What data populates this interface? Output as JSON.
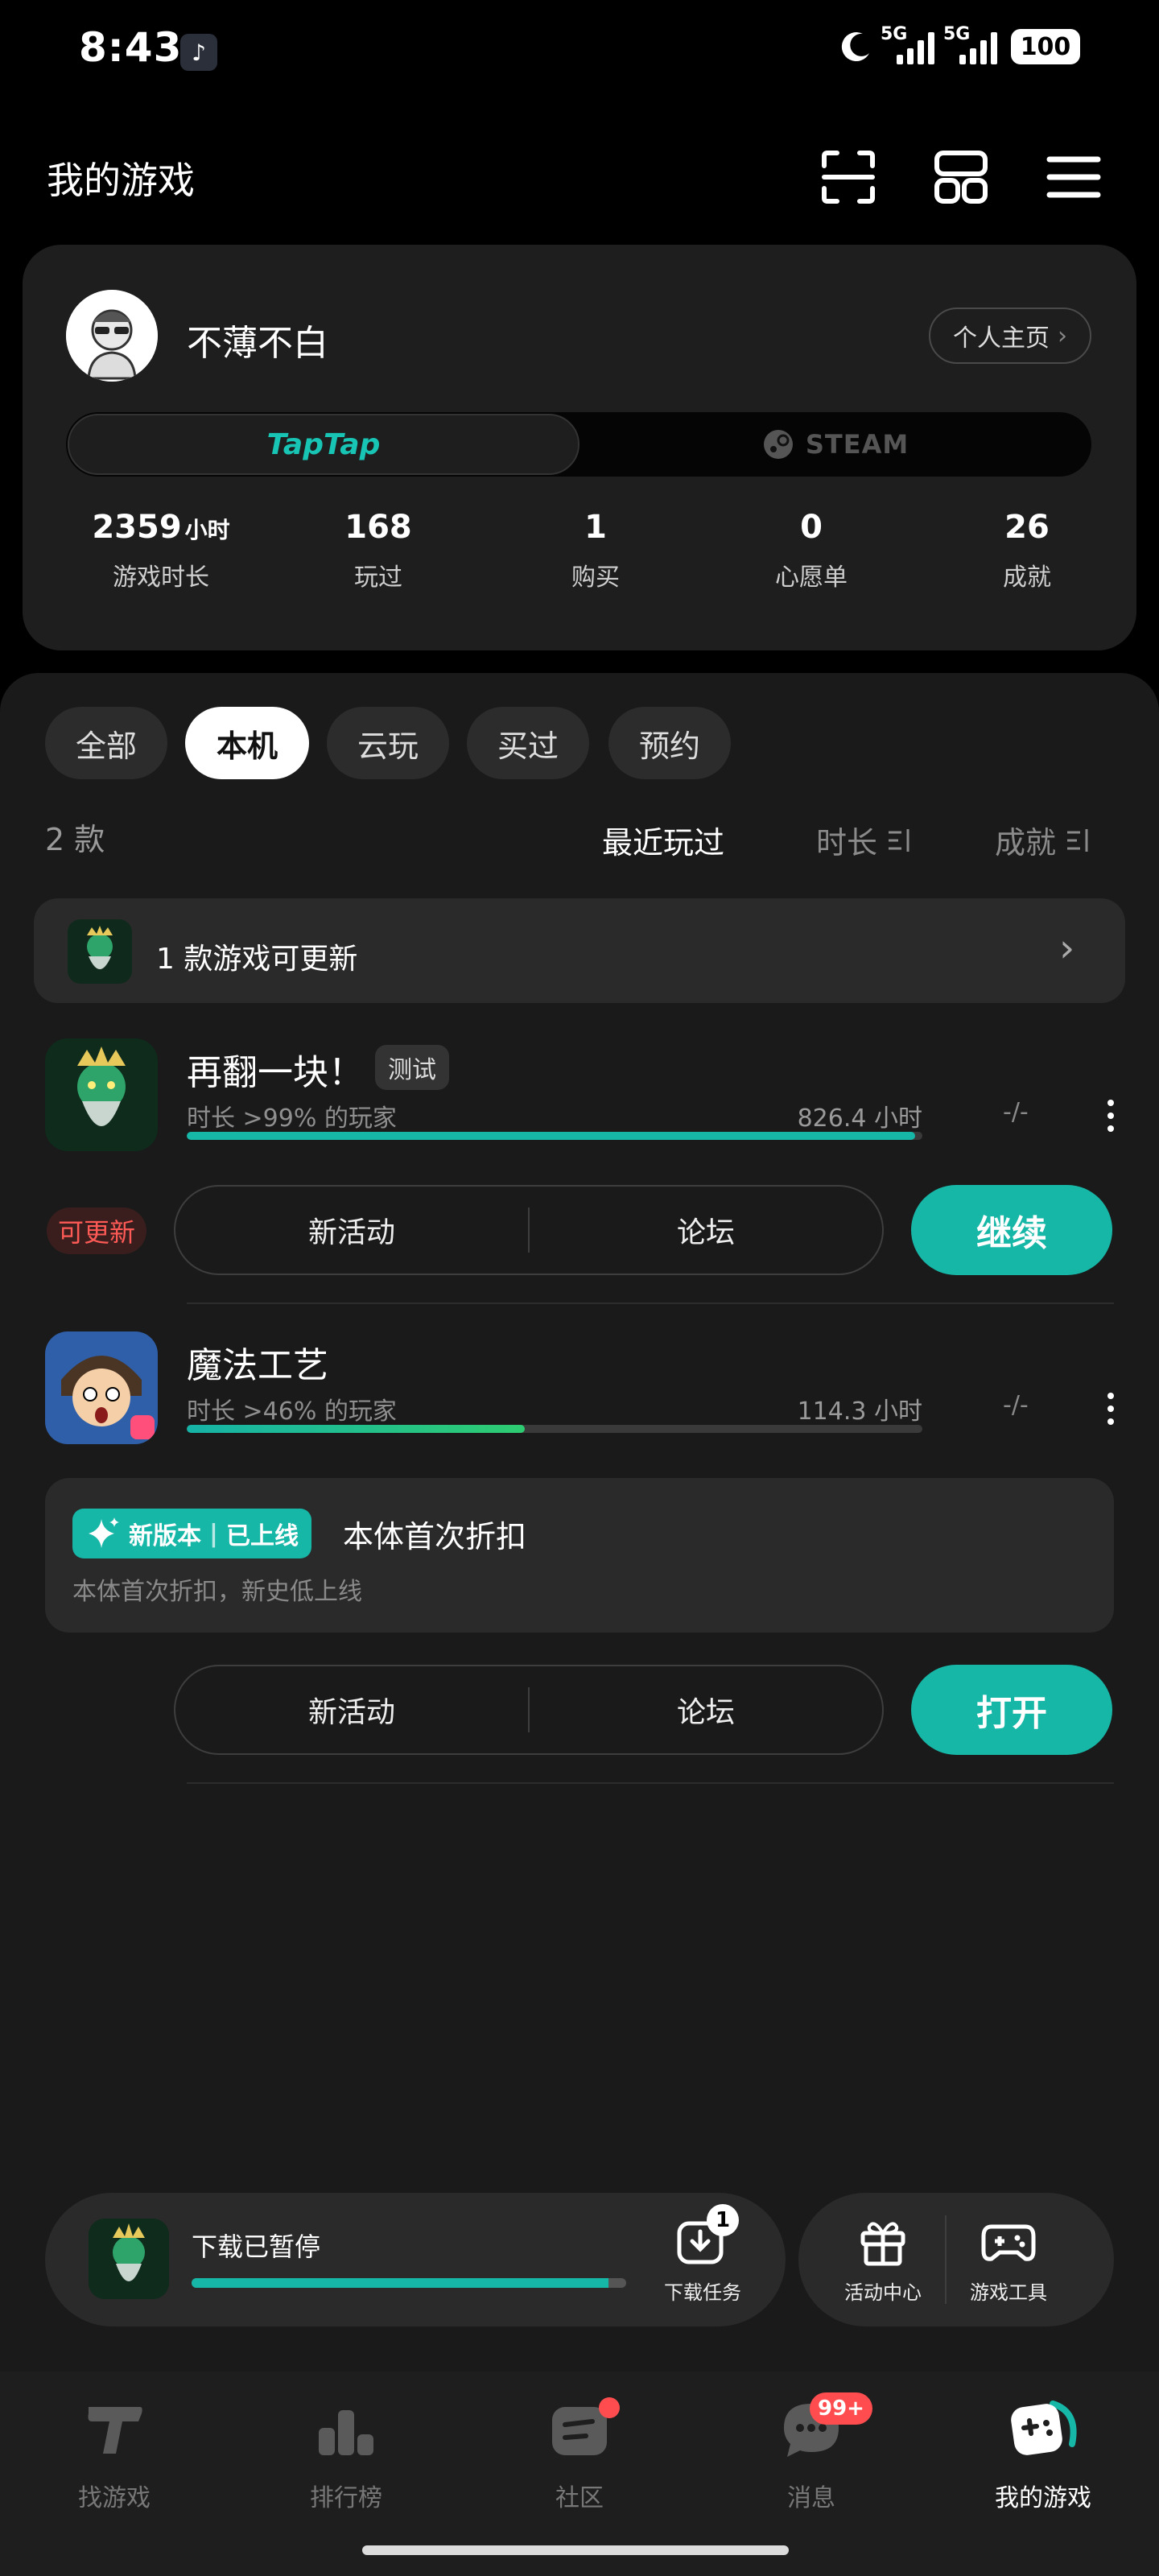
{
  "status_bar": {
    "time": "8:43",
    "sig1": "5G",
    "sig2": "5G",
    "battery": "100"
  },
  "header": {
    "title": "我的游戏"
  },
  "profile": {
    "username": "不薄不白",
    "profile_button": "个人主页",
    "platforms": [
      "TapTap",
      "STEAM"
    ],
    "stats": [
      {
        "value": "2359",
        "unit": "小时",
        "label": "游戏时长"
      },
      {
        "value": "168",
        "unit": "",
        "label": "玩过"
      },
      {
        "value": "1",
        "unit": "",
        "label": "购买"
      },
      {
        "value": "0",
        "unit": "",
        "label": "心愿单"
      },
      {
        "value": "26",
        "unit": "",
        "label": "成就"
      }
    ]
  },
  "filters": [
    "全部",
    "本机",
    "云玩",
    "买过",
    "预约"
  ],
  "count": "2 款",
  "sort": [
    "最近玩过",
    "时长",
    "成就"
  ],
  "update_notice": "1 款游戏可更新",
  "games": [
    {
      "title": "再翻一块！",
      "tag": "测试",
      "sub": "时长 >99% 的玩家",
      "hours": "826.4 小时",
      "progress": 0.99,
      "achievement": "-/-",
      "badge": "可更新",
      "actions": [
        "新活动",
        "论坛"
      ],
      "cta": "继续"
    },
    {
      "title": "魔法工艺",
      "sub": "时长 >46% 的玩家",
      "hours": "114.3 小时",
      "progress": 0.46,
      "achievement": "-/-",
      "news_badge_1": "新版本",
      "news_badge_2": "已上线",
      "news_title": "本体首次折扣",
      "news_desc": "本体首次折扣，新史低上线",
      "actions": [
        "新活动",
        "论坛"
      ],
      "cta": "打开"
    }
  ],
  "download": {
    "status": "下载已暂停",
    "progress": 0.96,
    "task_label": "下载任务",
    "task_count": "1"
  },
  "tools": [
    "活动中心",
    "游戏工具"
  ],
  "nav": [
    {
      "label": "找游戏"
    },
    {
      "label": "排行榜"
    },
    {
      "label": "社区"
    },
    {
      "label": "消息",
      "badge": "99+"
    },
    {
      "label": "我的游戏"
    }
  ],
  "colors": {
    "accent": "#17b7a8",
    "alert": "#ff4d4f"
  }
}
